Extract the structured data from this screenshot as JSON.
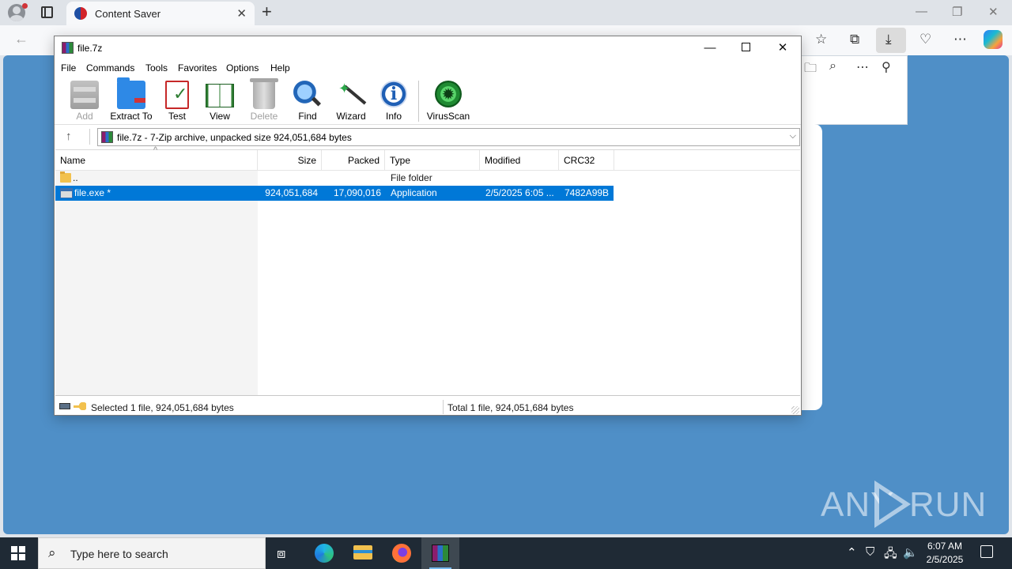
{
  "browser": {
    "tab_title": "Content Saver",
    "tab_close": "✕",
    "new_tab": "+",
    "window_controls": {
      "minimize": "—",
      "restore": "❐",
      "close": "✕"
    },
    "nav_back": "←"
  },
  "winrar": {
    "title": "file.7z",
    "window_controls": {
      "minimize": "—",
      "close": "✕"
    },
    "menu": [
      "File",
      "Commands",
      "Tools",
      "Favorites",
      "Options",
      "Help"
    ],
    "toolbar": [
      {
        "label": "Add",
        "icon": "add-archive-icon",
        "enabled": false
      },
      {
        "label": "Extract To",
        "icon": "extract-folder-icon",
        "enabled": true
      },
      {
        "label": "Test",
        "icon": "test-clipboard-icon",
        "enabled": true
      },
      {
        "label": "View",
        "icon": "view-book-icon",
        "enabled": true
      },
      {
        "label": "Delete",
        "icon": "trash-icon",
        "enabled": false
      },
      {
        "label": "Find",
        "icon": "magnifier-icon",
        "enabled": true
      },
      {
        "label": "Wizard",
        "icon": "wand-icon",
        "enabled": true
      },
      {
        "label": "Info",
        "icon": "info-icon",
        "enabled": true
      },
      {
        "label": "VirusScan",
        "icon": "virus-scan-icon",
        "enabled": true
      }
    ],
    "path": "file.7z - 7-Zip archive, unpacked size 924,051,684 bytes",
    "columns": [
      "Name",
      "Size",
      "Packed",
      "Type",
      "Modified",
      "CRC32"
    ],
    "rows": [
      {
        "name": "..",
        "size": "",
        "packed": "",
        "type": "File folder",
        "modified": "",
        "crc": "",
        "selected": false,
        "icon": "folder-icon"
      },
      {
        "name": "file.exe *",
        "size": "924,051,684",
        "packed": "17,090,016",
        "type": "Application",
        "modified": "2/5/2025 6:05 ...",
        "crc": "7482A99B",
        "selected": true,
        "icon": "executable-icon"
      }
    ],
    "status_left": "Selected 1 file, 924,051,684 bytes",
    "status_right": "Total 1 file, 924,051,684 bytes"
  },
  "watermark": {
    "left": "ANY",
    "right": "RUN"
  },
  "taskbar": {
    "search_placeholder": "Type here to search",
    "time": "6:07 AM",
    "date": "2/5/2025"
  },
  "colors": {
    "desktop": "#4f8fc7",
    "selection": "#0078d7",
    "taskbar": "#1f2a35"
  }
}
